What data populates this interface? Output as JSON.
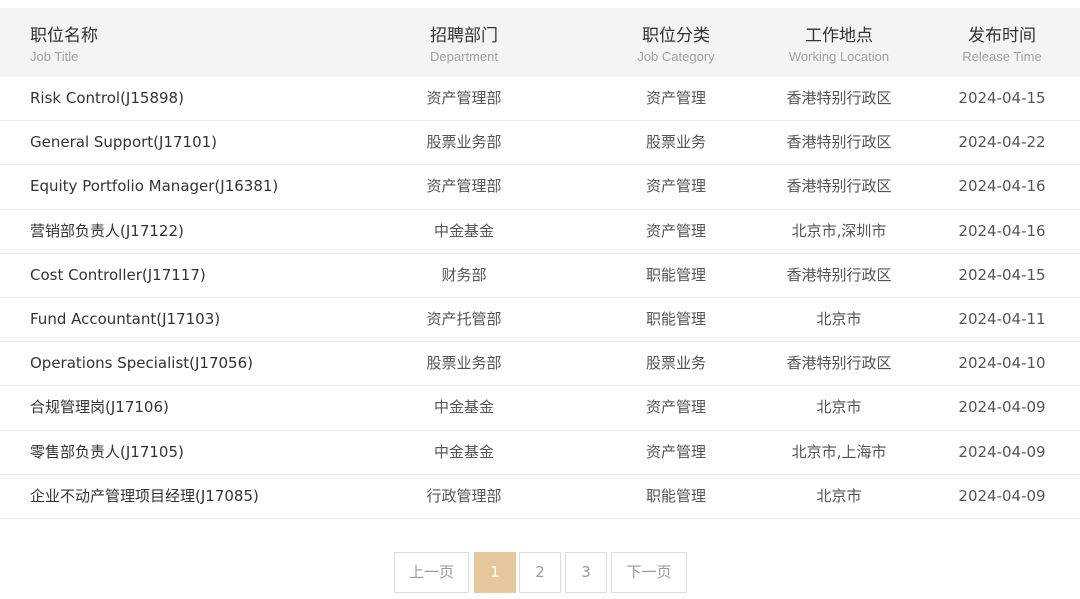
{
  "headers": {
    "title": {
      "zh": "职位名称",
      "en": "Job Title"
    },
    "dept": {
      "zh": "招聘部门",
      "en": "Department"
    },
    "category": {
      "zh": "职位分类",
      "en": "Job Category"
    },
    "location": {
      "zh": "工作地点",
      "en": "Working Location"
    },
    "time": {
      "zh": "发布时间",
      "en": "Release Time"
    }
  },
  "rows": [
    {
      "title": "Risk Control(J15898)",
      "dept": "资产管理部",
      "category": "资产管理",
      "location": "香港特别行政区",
      "time": "2024-04-15"
    },
    {
      "title": "General Support(J17101)",
      "dept": "股票业务部",
      "category": "股票业务",
      "location": "香港特别行政区",
      "time": "2024-04-22"
    },
    {
      "title": "Equity Portfolio Manager(J16381)",
      "dept": "资产管理部",
      "category": "资产管理",
      "location": "香港特别行政区",
      "time": "2024-04-16"
    },
    {
      "title": "营销部负责人(J17122)",
      "dept": "中金基金",
      "category": "资产管理",
      "location": "北京市,深圳市",
      "time": "2024-04-16"
    },
    {
      "title": "Cost Controller(J17117)",
      "dept": "财务部",
      "category": "职能管理",
      "location": "香港特别行政区",
      "time": "2024-04-15"
    },
    {
      "title": "Fund Accountant(J17103)",
      "dept": "资产托管部",
      "category": "职能管理",
      "location": "北京市",
      "time": "2024-04-11"
    },
    {
      "title": "Operations Specialist(J17056)",
      "dept": "股票业务部",
      "category": "股票业务",
      "location": "香港特别行政区",
      "time": "2024-04-10"
    },
    {
      "title": "合规管理岗(J17106)",
      "dept": "中金基金",
      "category": "资产管理",
      "location": "北京市",
      "time": "2024-04-09"
    },
    {
      "title": "零售部负责人(J17105)",
      "dept": "中金基金",
      "category": "资产管理",
      "location": "北京市,上海市",
      "time": "2024-04-09"
    },
    {
      "title": "企业不动产管理项目经理(J17085)",
      "dept": "行政管理部",
      "category": "职能管理",
      "location": "北京市",
      "time": "2024-04-09"
    }
  ],
  "pagination": {
    "prev": "上一页",
    "pages": [
      "1",
      "2",
      "3"
    ],
    "current": "1",
    "next": "下一页"
  },
  "colors": {
    "accent": "#e6c79c",
    "header_bg": "#f4f4f4"
  }
}
